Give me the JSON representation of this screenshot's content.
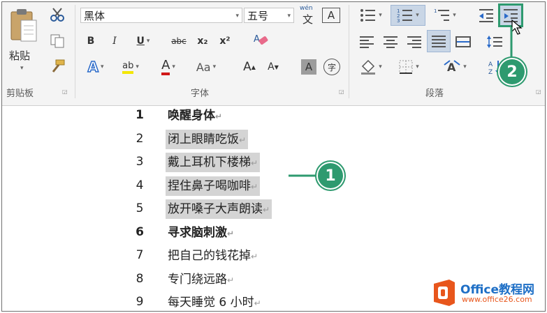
{
  "ribbon": {
    "clipboard": {
      "paste_label": "粘贴",
      "group_label": "剪贴板"
    },
    "font": {
      "font_name": "黑体",
      "font_size": "五号",
      "pinyin_top": "wén",
      "pinyin_char": "文",
      "char_border": "A",
      "bold": "B",
      "italic": "I",
      "underline": "U",
      "strike": "abc",
      "subscript": "x₂",
      "superscript": "x²",
      "text_effects": "A",
      "highlight": "ab",
      "font_color": "A",
      "change_case": "Aa",
      "grow": "A",
      "shrink": "A",
      "shading": "A",
      "enclose": "字",
      "group_label": "字体"
    },
    "paragraph": {
      "group_label": "段落"
    }
  },
  "document": {
    "lines": [
      {
        "num": "1",
        "text": "唤醒身体",
        "bold": true,
        "selected": false
      },
      {
        "num": "2",
        "text": "闭上眼睛吃饭",
        "bold": false,
        "selected": true
      },
      {
        "num": "3",
        "text": "戴上耳机下楼梯",
        "bold": false,
        "selected": true
      },
      {
        "num": "4",
        "text": "捏住鼻子喝咖啡",
        "bold": false,
        "selected": true
      },
      {
        "num": "5",
        "text": "放开嗓子大声朗读",
        "bold": false,
        "selected": true
      },
      {
        "num": "6",
        "text": "寻求脑刺激",
        "bold": true,
        "selected": false
      },
      {
        "num": "7",
        "text": "把自己的钱花掉",
        "bold": false,
        "selected": false
      },
      {
        "num": "8",
        "text": "专门绕远路",
        "bold": false,
        "selected": false
      },
      {
        "num": "9",
        "text": "每天睡觉 6 小时",
        "bold": false,
        "selected": false
      }
    ],
    "paragraph_mark": "↵"
  },
  "callouts": {
    "one": "1",
    "two": "2"
  },
  "watermark": {
    "brand": "Office教程网",
    "url": "www.office26.com"
  },
  "colors": {
    "accent": "#2e9a6f",
    "selection": "#d4d4d4",
    "logo_orange": "#e8561c"
  }
}
